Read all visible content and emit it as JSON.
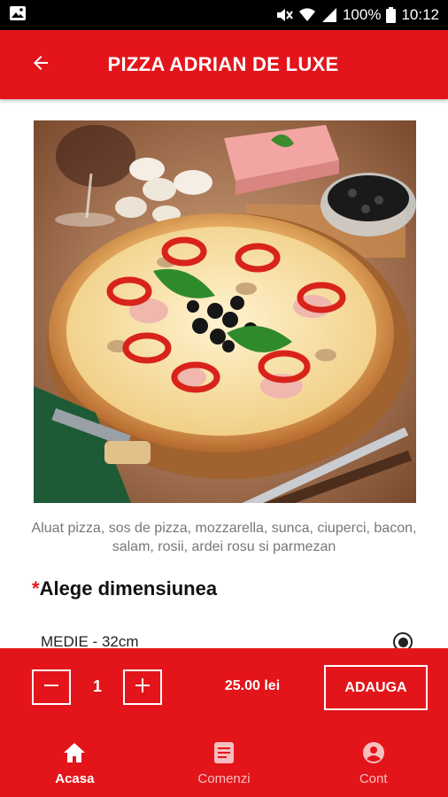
{
  "status_bar": {
    "battery": "100%",
    "time": "10:12",
    "icons": [
      "image-icon",
      "mute-icon",
      "wifi-icon",
      "signal-icon",
      "battery-icon"
    ]
  },
  "app_bar": {
    "title": "PIZZA ADRIAN DE LUXE",
    "back_icon": "arrow-back-icon"
  },
  "product": {
    "image_desc_icon": "pizza-photo",
    "description": "Aluat pizza, sos de pizza, mozzarella, sunca, ciuperci, bacon, salam, rosii, ardei rosu si parmezan"
  },
  "size_section": {
    "required_marker": "*",
    "title": "Alege dimensiunea",
    "options": [
      {
        "label": "MEDIE - 32cm",
        "selected": true
      }
    ]
  },
  "order_bar": {
    "quantity": "1",
    "price": "25.00 lei",
    "add_label": "ADAUGA",
    "minus_icon": "minus-icon",
    "plus_icon": "plus-icon"
  },
  "bottom_nav": {
    "items": [
      {
        "label": "Acasa",
        "icon": "home-icon",
        "active": true
      },
      {
        "label": "Comenzi",
        "icon": "orders-icon",
        "active": false
      },
      {
        "label": "Cont",
        "icon": "account-icon",
        "active": false
      }
    ]
  },
  "colors": {
    "primary": "#e3151b",
    "status_bar": "#000000",
    "text_muted": "#777777"
  }
}
